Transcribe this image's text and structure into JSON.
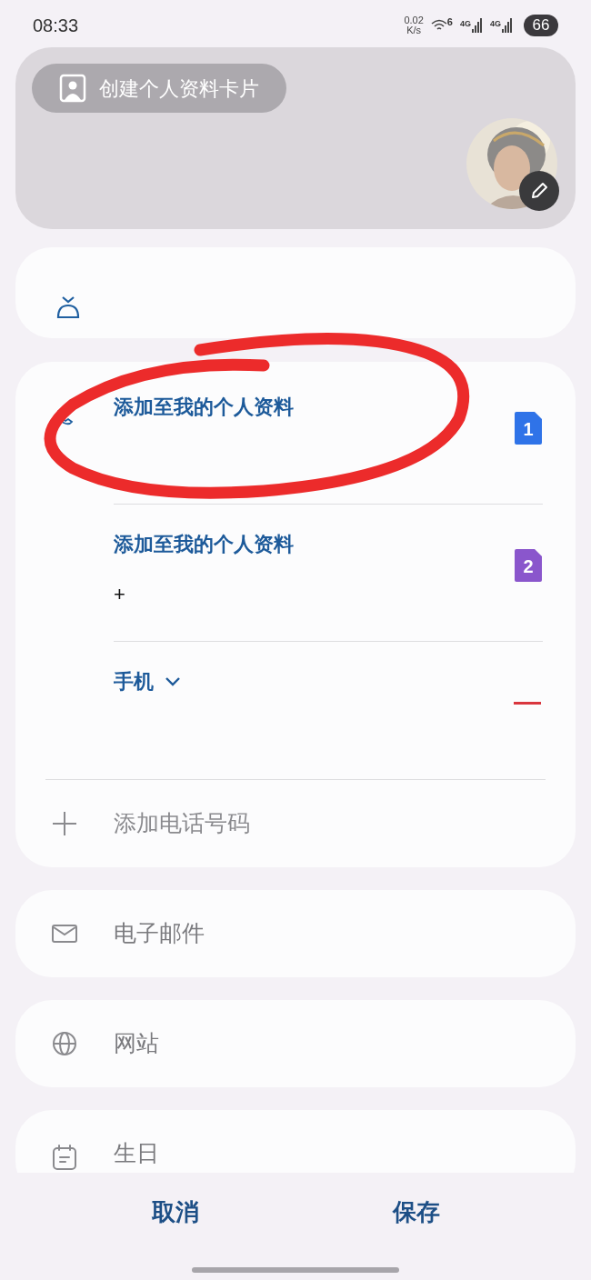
{
  "status_bar": {
    "time": "08:33",
    "net_speed": "0.02",
    "net_unit": "K/s",
    "wifi_badge": "6",
    "signals": [
      "4G",
      "4G"
    ],
    "battery": "66"
  },
  "header": {
    "create_card_button": "创建个人资料卡片"
  },
  "phones": [
    {
      "label": "添加至我的个人资料",
      "sim": "1",
      "color": "#2f73e8",
      "kind": "sim"
    },
    {
      "label": "添加至我的个人资料",
      "value": "+",
      "sim": "2",
      "color": "#8a56cc",
      "kind": "sim"
    },
    {
      "label": "手机",
      "kind": "remove",
      "dropdown": true
    }
  ],
  "add_phone": "添加电话号码",
  "fields": [
    {
      "label": "电子邮件",
      "kind": "email"
    },
    {
      "label": "网站",
      "kind": "website"
    },
    {
      "label": "生日",
      "kind": "birthday"
    }
  ],
  "annotation": {
    "kind": "ellipse"
  },
  "footer": {
    "buttons": [
      "取消",
      "保存"
    ]
  }
}
